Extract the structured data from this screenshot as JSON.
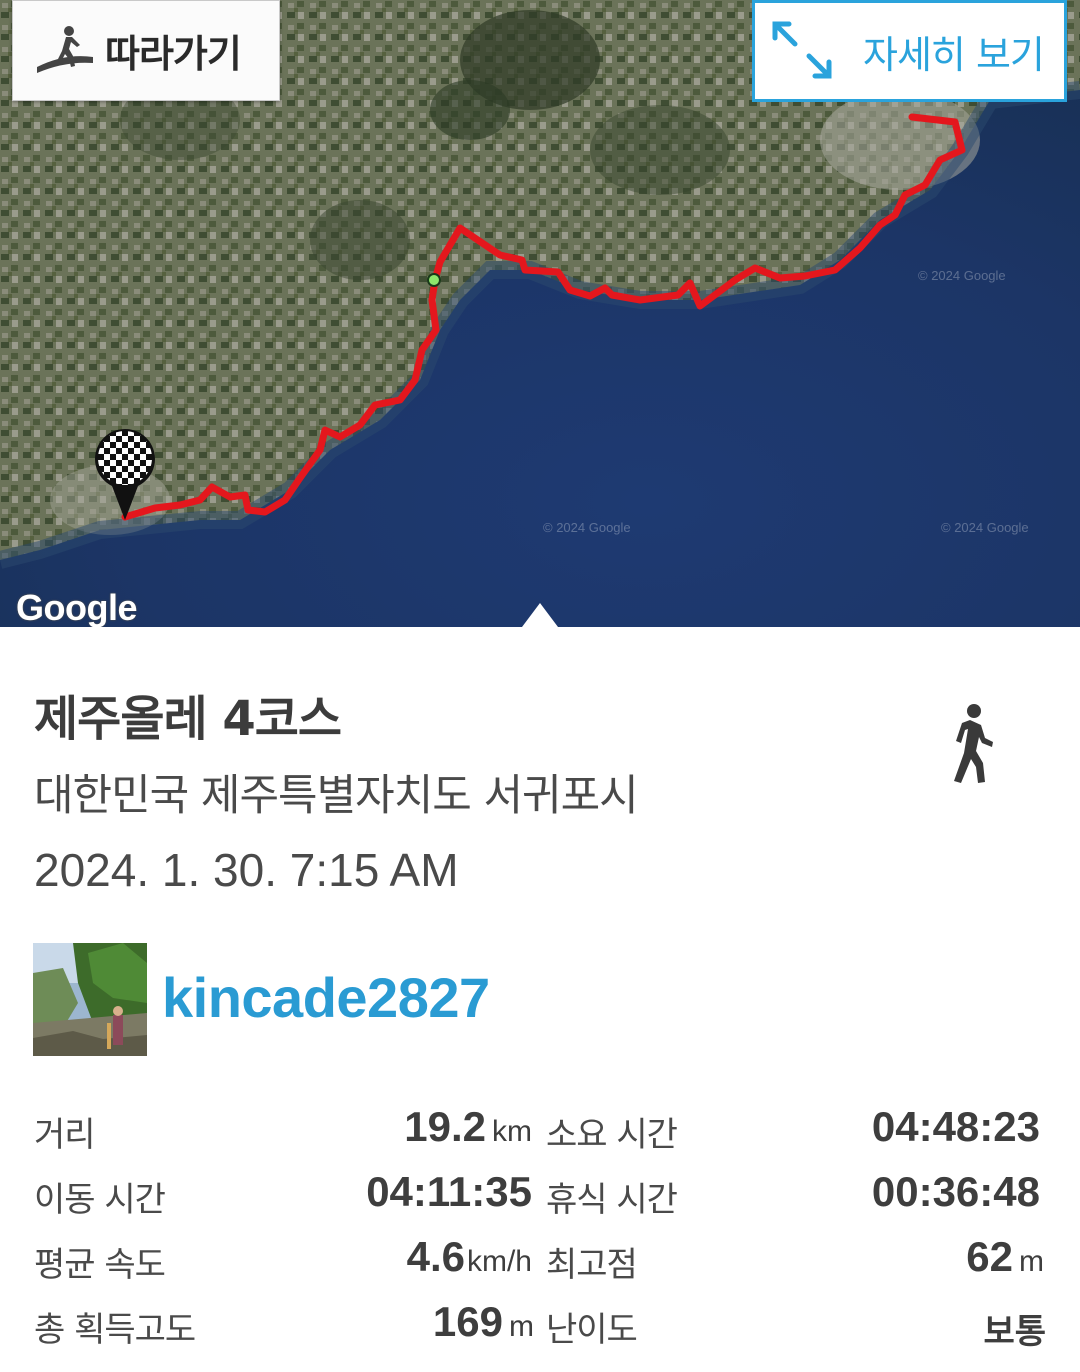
{
  "map": {
    "follow_label": "따라가기",
    "detail_label": "자세히 보기",
    "google_logo": "Google",
    "copyright": "© 2024 Google",
    "accent_blue": "#2aa3dc",
    "route_color": "#e4171d"
  },
  "activity": {
    "title": "제주올레 4코스",
    "location": "대한민국 제주특별자치도 서귀포시",
    "datetime": "2024. 1. 30. 7:15 AM",
    "username": "kincade2827",
    "activity_icon": "walking-person-icon"
  },
  "stats": {
    "distance": {
      "label": "거리",
      "value": "19.2",
      "unit": "km"
    },
    "total_time": {
      "label": "소요 시간",
      "value": "04:48:23"
    },
    "moving_time": {
      "label": "이동 시간",
      "value": "04:11:35"
    },
    "rest_time": {
      "label": "휴식 시간",
      "value": "00:36:48"
    },
    "avg_speed": {
      "label": "평균 속도",
      "value": "4.6",
      "unit": "km/h"
    },
    "max_elevation": {
      "label": "최고점",
      "value": "62",
      "unit": "m"
    },
    "total_ascent": {
      "label": "총 획득고도",
      "value": "169",
      "unit": "m"
    },
    "difficulty": {
      "label": "난이도",
      "value": "보통"
    }
  }
}
